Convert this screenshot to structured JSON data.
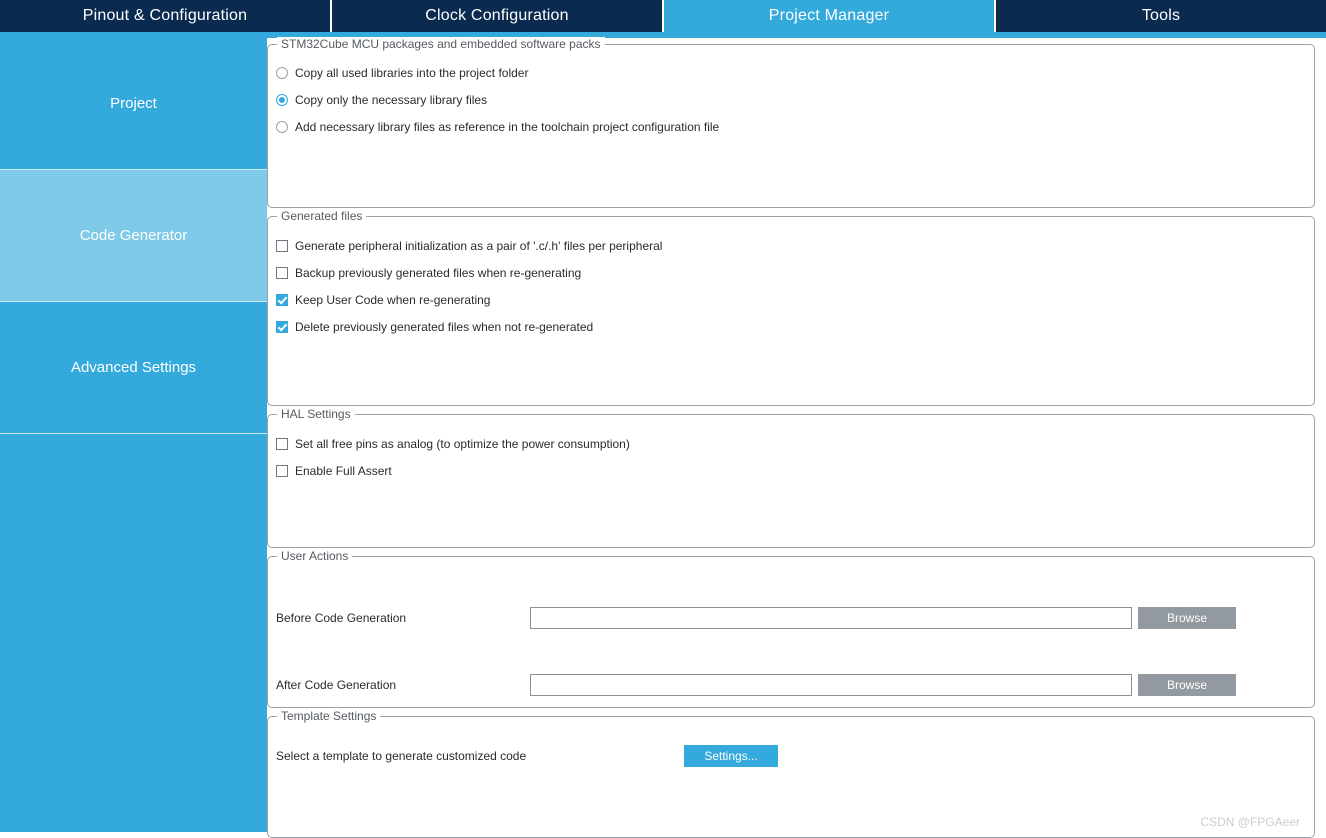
{
  "tabs": [
    {
      "label": "Pinout & Configuration",
      "active": false
    },
    {
      "label": "Clock Configuration",
      "active": false
    },
    {
      "label": "Project Manager",
      "active": true
    },
    {
      "label": "Tools",
      "active": false
    }
  ],
  "sidebar": {
    "items": [
      {
        "label": "Project",
        "selected": false
      },
      {
        "label": "Code Generator",
        "selected": true
      },
      {
        "label": "Advanced Settings",
        "selected": false
      }
    ]
  },
  "groups": {
    "packages": {
      "title": "STM32Cube MCU packages and embedded software packs",
      "options": [
        {
          "label": "Copy all used libraries into the project folder",
          "checked": false
        },
        {
          "label": "Copy only the necessary library files",
          "checked": true
        },
        {
          "label": "Add necessary library files as reference in the toolchain project configuration file",
          "checked": false
        }
      ]
    },
    "generated_files": {
      "title": "Generated files",
      "options": [
        {
          "label": "Generate peripheral initialization as a pair of '.c/.h' files per peripheral",
          "checked": false
        },
        {
          "label": "Backup previously generated files when re-generating",
          "checked": false
        },
        {
          "label": "Keep User Code when re-generating",
          "checked": true
        },
        {
          "label": "Delete previously generated files when not re-generated",
          "checked": true
        }
      ]
    },
    "hal_settings": {
      "title": "HAL Settings",
      "options": [
        {
          "label": "Set all free pins as analog (to optimize the power consumption)",
          "checked": false
        },
        {
          "label": "Enable Full Assert",
          "checked": false
        }
      ]
    },
    "user_actions": {
      "title": "User Actions",
      "before": {
        "label": "Before Code Generation",
        "value": "",
        "placeholder": "",
        "button": "Browse"
      },
      "after": {
        "label": "After Code Generation",
        "value": "",
        "placeholder": "",
        "button": "Browse"
      }
    },
    "template_settings": {
      "title": "Template Settings",
      "label": "Select a template to generate customized code",
      "button": "Settings..."
    }
  },
  "watermark": "CSDN @FPGAeer",
  "colors": {
    "tab_inactive": "#0b2a4f",
    "tab_active": "#33a9dc",
    "accent": "#33a9dc",
    "sidebar": "#33a9dc",
    "sidebar_selected": "#7fc9e9",
    "browse_button": "#9399a0"
  }
}
